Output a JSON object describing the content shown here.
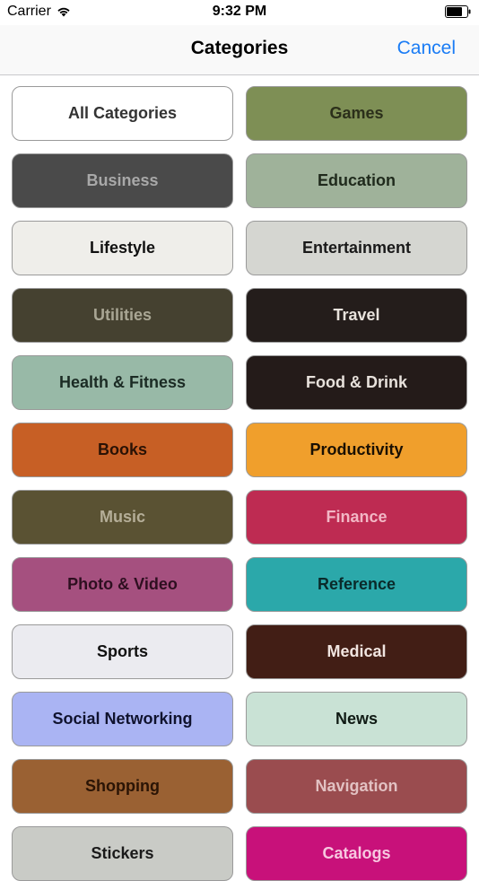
{
  "status": {
    "carrier": "Carrier",
    "time": "9:32 PM"
  },
  "nav": {
    "title": "Categories",
    "cancel": "Cancel"
  },
  "colors": {
    "accent": "#1a7cf5"
  },
  "icons": [
    "wifi-icon",
    "battery-icon"
  ],
  "categories": [
    {
      "label": "All Categories",
      "bg": "#ffffff",
      "fg": "#333333"
    },
    {
      "label": "Games",
      "bg": "#7e8f55",
      "fg": "#2b2f1a"
    },
    {
      "label": "Business",
      "bg": "#4a4a4a",
      "fg": "#a8a8a8"
    },
    {
      "label": "Education",
      "bg": "#9fb29a",
      "fg": "#1f2a1c"
    },
    {
      "label": "Lifestyle",
      "bg": "#efeeea",
      "fg": "#111111"
    },
    {
      "label": "Entertainment",
      "bg": "#d5d6d1",
      "fg": "#1a1a1a"
    },
    {
      "label": "Utilities",
      "bg": "#454130",
      "fg": "#a9a694"
    },
    {
      "label": "Travel",
      "bg": "#241d1b",
      "fg": "#e8e2dc"
    },
    {
      "label": "Health & Fitness",
      "bg": "#98b9a7",
      "fg": "#1b2b24"
    },
    {
      "label": "Food & Drink",
      "bg": "#241b19",
      "fg": "#e8e2dc"
    },
    {
      "label": "Books",
      "bg": "#c75f25",
      "fg": "#2a1205"
    },
    {
      "label": "Productivity",
      "bg": "#f09f2c",
      "fg": "#1a1003"
    },
    {
      "label": "Music",
      "bg": "#5a5233",
      "fg": "#b5ae98"
    },
    {
      "label": "Finance",
      "bg": "#be2b52",
      "fg": "#f2b7c5"
    },
    {
      "label": "Photo & Video",
      "bg": "#a5507f",
      "fg": "#2e0f20"
    },
    {
      "label": "Reference",
      "bg": "#2ba8aa",
      "fg": "#0a2a2a"
    },
    {
      "label": "Sports",
      "bg": "#ebebf0",
      "fg": "#111111"
    },
    {
      "label": "Medical",
      "bg": "#421e15",
      "fg": "#f1e5e0"
    },
    {
      "label": "Social Networking",
      "bg": "#aab4f3",
      "fg": "#10132e"
    },
    {
      "label": "News",
      "bg": "#c9e2d5",
      "fg": "#0f1a14"
    },
    {
      "label": "Shopping",
      "bg": "#9a6133",
      "fg": "#2a1405"
    },
    {
      "label": "Navigation",
      "bg": "#9a4c4f",
      "fg": "#e2c1c2"
    },
    {
      "label": "Stickers",
      "bg": "#c9cbc6",
      "fg": "#1a1a1a"
    },
    {
      "label": "Catalogs",
      "bg": "#c8117a",
      "fg": "#f7c8e0"
    }
  ]
}
